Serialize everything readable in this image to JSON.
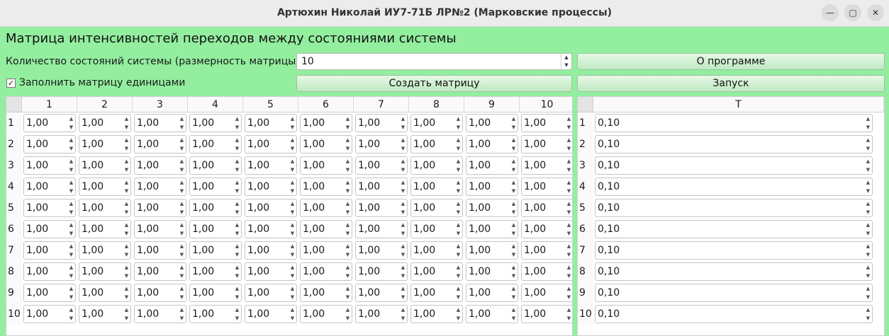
{
  "window": {
    "title": "Артюхин Николай ИУ7-71Б ЛР№2 (Марковские процессы)",
    "minimize_glyph": "—",
    "maximize_glyph": "▢",
    "close_glyph": "✕"
  },
  "header": "Матрица интенсивностей переходов между состояниями системы",
  "states": {
    "label": "Количество состояний системы (размерность матрицы):",
    "value": "10"
  },
  "fill_ones": {
    "label": "Заполнить матрицу единицами",
    "checked": true,
    "mark": "✓"
  },
  "buttons": {
    "about": "О программе",
    "create": "Создать матрицу",
    "run": "Запуск"
  },
  "matrix": {
    "col_headers": [
      "1",
      "2",
      "3",
      "4",
      "5",
      "6",
      "7",
      "8",
      "9",
      "10"
    ],
    "row_headers": [
      "1",
      "2",
      "3",
      "4",
      "5",
      "6",
      "7",
      "8",
      "9",
      "10"
    ],
    "cell_value": "1,00"
  },
  "t_table": {
    "header": "T",
    "row_headers": [
      "1",
      "2",
      "3",
      "4",
      "5",
      "6",
      "7",
      "8",
      "9",
      "10"
    ],
    "values": [
      "0,10",
      "0,10",
      "0,10",
      "0,10",
      "0,10",
      "0,10",
      "0,10",
      "0,10",
      "0,10",
      "0,10"
    ]
  }
}
